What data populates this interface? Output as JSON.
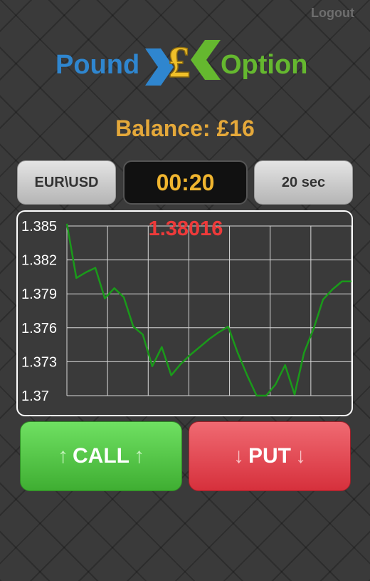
{
  "header": {
    "logout_label": "Logout"
  },
  "logo": {
    "word_left": "Pound",
    "symbol": "£",
    "word_right": "Option"
  },
  "balance": {
    "text": "Balance: £16"
  },
  "controls": {
    "pair": "EUR\\USD",
    "timer": "00:20",
    "duration": "20 sec"
  },
  "chart_data": {
    "type": "line",
    "current_value": "1.38016",
    "y_ticks": [
      "1.385",
      "1.382",
      "1.379",
      "1.376",
      "1.373",
      "1.37"
    ],
    "ylim": [
      1.37,
      1.385
    ],
    "x": [
      0,
      1,
      2,
      3,
      4,
      5,
      6,
      7,
      8,
      9,
      10,
      11,
      12,
      13,
      14,
      15,
      16,
      17,
      18,
      19,
      20,
      21,
      22,
      23,
      24,
      25,
      26,
      27,
      28,
      29,
      30
    ],
    "values": [
      1.3852,
      1.3804,
      1.3809,
      1.3813,
      1.3786,
      1.3795,
      1.3787,
      1.3761,
      1.3754,
      1.3726,
      1.3743,
      1.3718,
      1.3728,
      1.3736,
      1.3743,
      1.375,
      1.3756,
      1.3761,
      1.3738,
      1.3718,
      1.37,
      1.37,
      1.371,
      1.3727,
      1.3701,
      1.3738,
      1.3759,
      1.3785,
      1.3794,
      1.3801,
      1.3801
    ],
    "line_color": "#1a9a1a",
    "grid": true
  },
  "actions": {
    "call_label": "CALL",
    "put_label": "PUT",
    "arrow_up": "↑",
    "arrow_down": "↓"
  }
}
